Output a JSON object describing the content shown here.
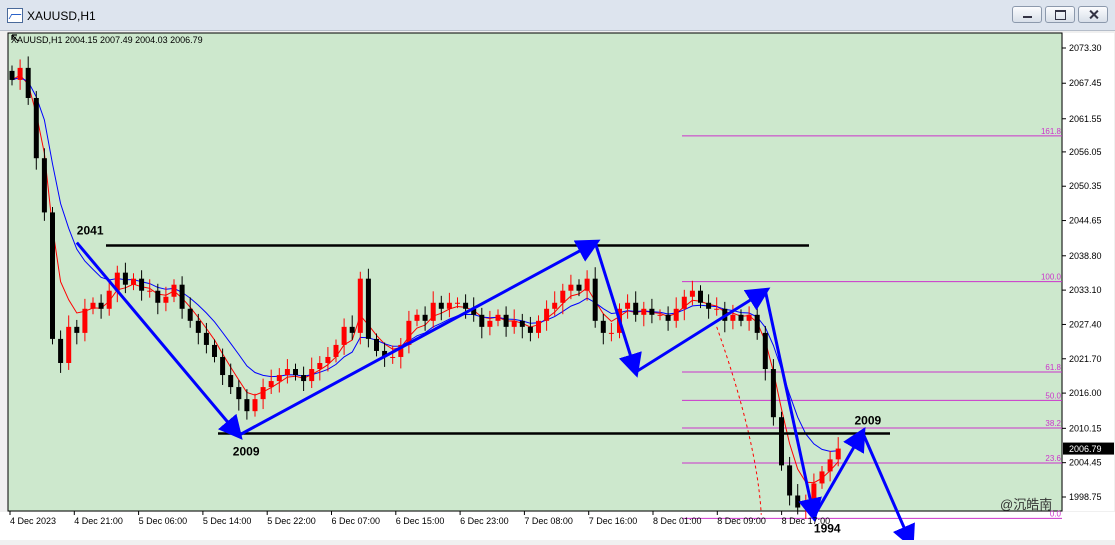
{
  "window": {
    "title": "XAUUSD,H1"
  },
  "chart_data": {
    "type": "candlestick",
    "symbol": "XAUUSD,H1",
    "ohlc_header": "XAUUSD,H1  2004.15 2007.49 2004.03 2006.79",
    "current_price": "2006.79",
    "ylim": [
      1995,
      2076
    ],
    "y_ticks": [
      "2073.30",
      "2067.45",
      "2061.55",
      "2056.05",
      "2050.35",
      "2044.65",
      "2038.80",
      "2033.10",
      "2027.40",
      "2021.70",
      "2016.00",
      "2010.15",
      "2004.45",
      "1998.75"
    ],
    "x_ticks": [
      "4 Dec 2023",
      "4 Dec 21:00",
      "5 Dec 06:00",
      "5 Dec 14:00",
      "5 Dec 22:00",
      "6 Dec 07:00",
      "6 Dec 15:00",
      "6 Dec 23:00",
      "7 Dec 08:00",
      "7 Dec 16:00",
      "8 Dec 01:00",
      "8 Dec 09:00",
      "8 Dec 17:00"
    ],
    "colors": {
      "background": "#cde8cd",
      "bull": "#ff0000",
      "bear": "#000000",
      "ma_fast": "#ff0000",
      "ma_slow": "#0000ff",
      "arrows": "#0000ff",
      "fibo": "#cc33cc",
      "level": "#000000"
    },
    "candles_close": [
      2068,
      2070,
      2065,
      2055,
      2046,
      2025,
      2021,
      2027,
      2026,
      2030,
      2031,
      2030,
      2033,
      2036,
      2034,
      2035,
      2033,
      2033,
      2031,
      2032,
      2034,
      2030,
      2028,
      2026,
      2024,
      2022,
      2019,
      2017,
      2015,
      2013,
      2015,
      2017,
      2018,
      2019,
      2020,
      2019,
      2018,
      2020,
      2021,
      2022,
      2024,
      2027,
      2026,
      2035,
      2025,
      2023,
      2022,
      2022,
      2024,
      2028,
      2029,
      2028,
      2031,
      2030,
      2031,
      2031,
      2030,
      2029,
      2027,
      2028,
      2029,
      2027,
      2028,
      2027,
      2026,
      2028,
      2030,
      2031,
      2033,
      2034,
      2033,
      2035,
      2028,
      2026,
      2026,
      2030,
      2031,
      2029,
      2030,
      2029,
      2029,
      2028,
      2030,
      2032,
      2033,
      2031,
      2030,
      2030,
      2028,
      2029,
      2028,
      2029,
      2026,
      2020,
      2012,
      2004,
      1999,
      1997,
      1998,
      2001,
      2003,
      2005,
      2006.79
    ],
    "levels": [
      {
        "label": "2041",
        "value": 2040.5
      },
      {
        "label": "2009",
        "value": 2009.3
      }
    ],
    "fibo": [
      {
        "label": "161.8",
        "value": 2058.7
      },
      {
        "label": "100.0",
        "value": 2034.5
      },
      {
        "label": "61.8",
        "value": 2019.5
      },
      {
        "label": "50.0",
        "value": 2014.8
      },
      {
        "label": "38.2",
        "value": 2010.2
      },
      {
        "label": "23.6",
        "value": 2004.4
      },
      {
        "label": "0.0",
        "value": 1995.2
      }
    ],
    "wave_points": [
      {
        "label": "2041",
        "x": 8,
        "y": 2041
      },
      {
        "label": "2009",
        "x": 28,
        "y": 2009
      },
      {
        "label": "",
        "x": 72,
        "y": 2041
      },
      {
        "label": "",
        "x": 77,
        "y": 2019.5
      },
      {
        "label": "",
        "x": 93,
        "y": 2033
      },
      {
        "label": "1994",
        "x": 99,
        "y": 1995.5
      },
      {
        "label": "2009",
        "x": 105,
        "y": 2009.5
      },
      {
        "label": "",
        "x": 111,
        "y": 1991
      }
    ],
    "watermark": "@沉皓南"
  }
}
